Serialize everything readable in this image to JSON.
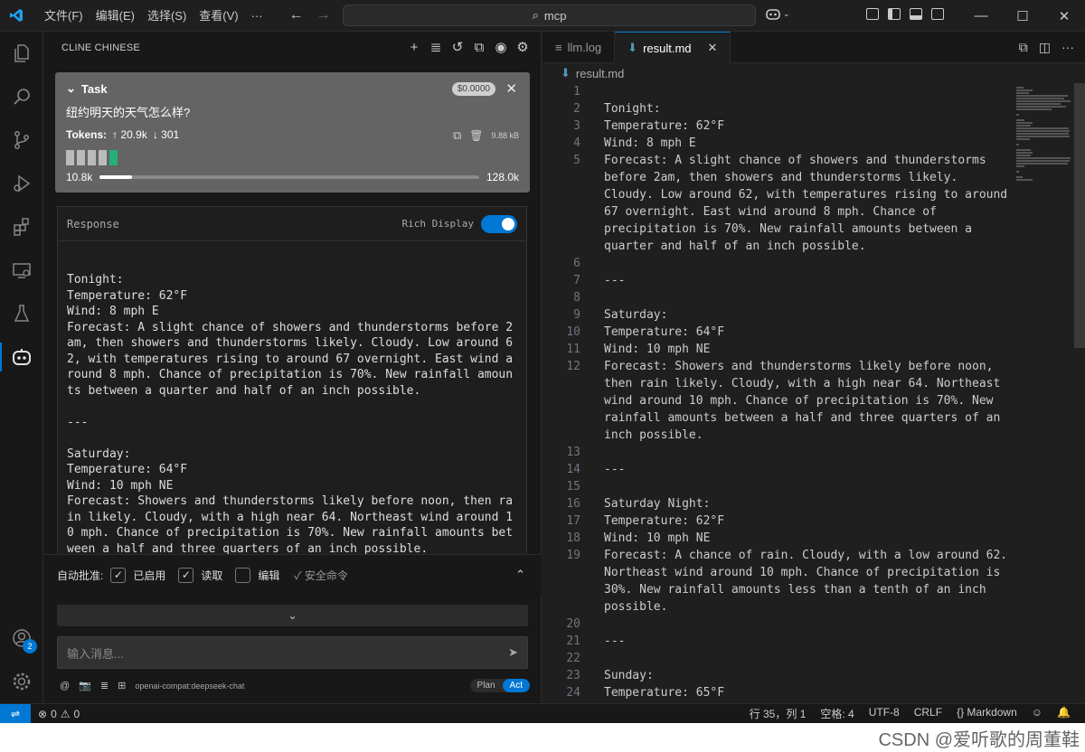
{
  "titlebar": {
    "menu": [
      "文件(F)",
      "编辑(E)",
      "选择(S)",
      "查看(V)",
      "···"
    ],
    "search": "mcp"
  },
  "sidebar": {
    "title": "CLINE CHINESE",
    "task": {
      "label": "Task",
      "cost": "$0.0000",
      "question": "纽约明天的天气怎么样?",
      "tokens_label": "Tokens:",
      "tokens_in": "↑ 20.9k",
      "tokens_out": "↓ 301",
      "size": "9.88 kB",
      "context_used": "10.8k",
      "context_max": "128.0k",
      "context_fraction": 0.084
    },
    "response": {
      "label": "Response",
      "rich_display_label": "Rich Display",
      "rich_display_on": true,
      "text": "Tonight:\nTemperature: 62°F\nWind: 8 mph E\nForecast: A slight chance of showers and thunderstorms before 2am, then showers and thunderstorms likely. Cloudy. Low around 62, with temperatures rising to around 67 overnight. East wind around 8 mph. Chance of precipitation is 70%. New rainfall amounts between a quarter and half of an inch possible.\n\n---\n\nSaturday:\nTemperature: 64°F\nWind: 10 mph NE\nForecast: Showers and thunderstorms likely before noon, then rain likely. Cloudy, with a high near 64. Northeast wind around 10 mph. Chance of precipitation is 70%. New rainfall amounts between a half and three quarters of an inch possible."
    },
    "auto_approve": {
      "label": "自动批准:",
      "enabled": "已启用",
      "read": "读取",
      "edit": "编辑",
      "safe": "✓ 安全命令"
    },
    "input_placeholder": "输入消息...",
    "model": "openai-compat:deepseek-chat",
    "plan": "Plan",
    "act": "Act"
  },
  "editor": {
    "tabs": [
      {
        "label": "llm.log"
      },
      {
        "label": "result.md"
      }
    ],
    "breadcrumb": "result.md",
    "lines": [
      {
        "n": "1",
        "t": ""
      },
      {
        "n": "2",
        "t": "Tonight:"
      },
      {
        "n": "3",
        "t": "Temperature: 62°F"
      },
      {
        "n": "4",
        "t": "Wind: 8 mph E"
      },
      {
        "n": "5",
        "t": "Forecast: A slight chance of showers and thunderstorms"
      },
      {
        "n": "",
        "t": "before 2am, then showers and thunderstorms likely."
      },
      {
        "n": "",
        "t": "Cloudy. Low around 62, with temperatures rising to around"
      },
      {
        "n": "",
        "t": "67 overnight. East wind around 8 mph. Chance of"
      },
      {
        "n": "",
        "t": "precipitation is 70%. New rainfall amounts between a"
      },
      {
        "n": "",
        "t": "quarter and half of an inch possible."
      },
      {
        "n": "6",
        "t": ""
      },
      {
        "n": "7",
        "t": "---"
      },
      {
        "n": "8",
        "t": ""
      },
      {
        "n": "9",
        "t": "Saturday:"
      },
      {
        "n": "10",
        "t": "Temperature: 64°F"
      },
      {
        "n": "11",
        "t": "Wind: 10 mph NE"
      },
      {
        "n": "12",
        "t": "Forecast: Showers and thunderstorms likely before noon,"
      },
      {
        "n": "",
        "t": "then rain likely. Cloudy, with a high near 64. Northeast"
      },
      {
        "n": "",
        "t": "wind around 10 mph. Chance of precipitation is 70%. New"
      },
      {
        "n": "",
        "t": "rainfall amounts between a half and three quarters of an"
      },
      {
        "n": "",
        "t": "inch possible."
      },
      {
        "n": "13",
        "t": ""
      },
      {
        "n": "14",
        "t": "---"
      },
      {
        "n": "15",
        "t": ""
      },
      {
        "n": "16",
        "t": "Saturday Night:"
      },
      {
        "n": "17",
        "t": "Temperature: 62°F"
      },
      {
        "n": "18",
        "t": "Wind: 10 mph NE"
      },
      {
        "n": "19",
        "t": "Forecast: A chance of rain. Cloudy, with a low around 62."
      },
      {
        "n": "",
        "t": "Northeast wind around 10 mph. Chance of precipitation is"
      },
      {
        "n": "",
        "t": "30%. New rainfall amounts less than a tenth of an inch"
      },
      {
        "n": "",
        "t": "possible."
      },
      {
        "n": "20",
        "t": ""
      },
      {
        "n": "21",
        "t": "---"
      },
      {
        "n": "22",
        "t": ""
      },
      {
        "n": "23",
        "t": "Sunday:"
      },
      {
        "n": "24",
        "t": "Temperature: 65°F"
      }
    ]
  },
  "statusbar": {
    "errors": "0",
    "warnings": "0",
    "position": "行 35，列 1",
    "spaces": "空格: 4",
    "encoding": "UTF-8",
    "eol": "CRLF",
    "language": "Markdown"
  },
  "accounts_badge": "2",
  "watermark": "CSDN @爱听歌的周董鞋",
  "colors": {
    "accent": "#0078d4",
    "green": "#25b07a"
  }
}
